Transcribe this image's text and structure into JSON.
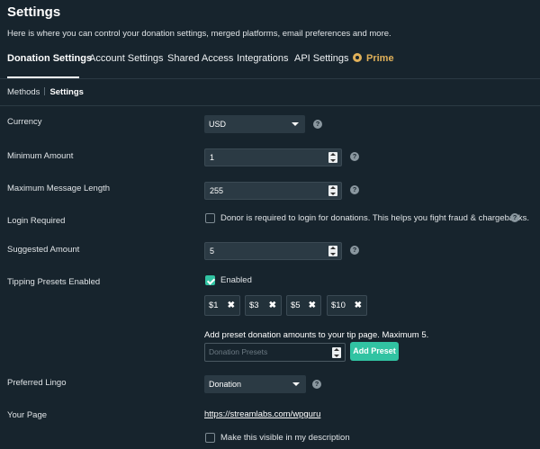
{
  "header": {
    "title": "Settings",
    "subtitle": "Here is where you can control your donation settings, merged platforms, email preferences and more."
  },
  "tabs": [
    {
      "label": "Donation Settings"
    },
    {
      "label": "Account Settings"
    },
    {
      "label": "Shared Access"
    },
    {
      "label": "Integrations"
    },
    {
      "label": "API Settings"
    },
    {
      "label": "Prime",
      "icon": "prime-icon"
    }
  ],
  "subnav": {
    "methods": "Methods",
    "settings": "Settings"
  },
  "form": {
    "currency": {
      "label": "Currency",
      "value": "USD"
    },
    "min_amount": {
      "label": "Minimum Amount",
      "value": "1"
    },
    "max_message": {
      "label": "Maximum Message Length",
      "value": "255"
    },
    "login_required": {
      "label": "Login Required",
      "checkbox_text": "Donor is required to login for donations. This helps you fight fraud & chargebacks.",
      "checked": false
    },
    "suggested": {
      "label": "Suggested Amount",
      "value": "5"
    },
    "tipping": {
      "label": "Tipping Presets Enabled",
      "checkbox_text": "Enabled",
      "checked": true,
      "presets": [
        "$1",
        "$3",
        "$5",
        "$10"
      ],
      "remove_glyph": "✖",
      "help_text": "Add preset donation amounts to your tip page. Maximum 5.",
      "input_placeholder": "Donation Presets",
      "add_button": "Add Preset"
    },
    "lingo": {
      "label": "Preferred Lingo",
      "value": "Donation"
    },
    "your_page": {
      "label": "Your Page",
      "url": "https://streamlabs.com/wpguru",
      "checkbox_text": "Make this visible in my description",
      "checked": false
    },
    "help_glyph": "?"
  },
  "colors": {
    "background": "#17242d",
    "accent": "#31c3a2",
    "prime": "#e0b059"
  }
}
